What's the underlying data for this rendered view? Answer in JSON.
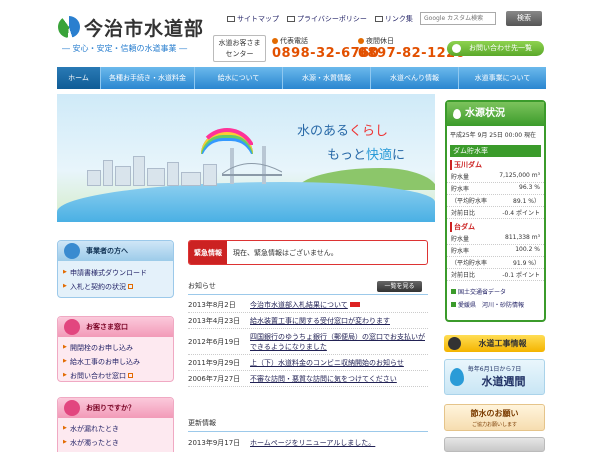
{
  "header": {
    "logo_title": "今治市水道部",
    "logo_sub": "― 安心・安定・信頼の水道事業 ―",
    "links": [
      "サイトマップ",
      "プライバシーポリシー",
      "リンク集"
    ],
    "search_placeholder": "Google カスタム検索",
    "search_button": "検索",
    "center_label_1": "水道お客さま",
    "center_label_2": "センター",
    "phone_main_label": "代表電話",
    "phone_main": "0898-32-6760",
    "phone_night_label": "夜間休日",
    "phone_night": "0897-82-1220",
    "contact_button": "お問い合わせ先一覧"
  },
  "nav": [
    "ホーム",
    "各種お手続き・水道料金",
    "給水について",
    "水源・水質情報",
    "水道べんり情報",
    "水道事業について"
  ],
  "hero": {
    "line1_a": "水のある",
    "line1_b": "くらし",
    "line2_a": "もっと",
    "line2_b": "快適",
    "line2_c": "に"
  },
  "dam": {
    "title": "水源状況",
    "date": "平成25年 9月 25日 00:00 現在",
    "subhead": "ダム貯水率",
    "dams": [
      {
        "name": "玉川ダム",
        "rows": [
          {
            "label": "貯水量",
            "value": "7,125,000 m³"
          },
          {
            "label": "貯水率",
            "value": "96.3 %"
          },
          {
            "label": "（平均貯水率",
            "value": "89.1 %）"
          },
          {
            "label": "対前日比",
            "value": "-0.4 ポイント"
          }
        ]
      },
      {
        "name": "台ダム",
        "rows": [
          {
            "label": "貯水量",
            "value": "811,338 m³"
          },
          {
            "label": "貯水率",
            "value": "100.2 %"
          },
          {
            "label": "（平均貯水率",
            "value": "91.9 %）"
          },
          {
            "label": "対前日比",
            "value": "-0.1 ポイント"
          }
        ]
      }
    ],
    "links": [
      "国土交通省データ",
      "愛媛県　河川・砂防情報"
    ]
  },
  "left": {
    "business": {
      "title": "事業者の方へ",
      "items": [
        "申請書様式ダウンロード",
        "入札と契約の状況"
      ]
    },
    "customer": {
      "title": "お客さま窓口",
      "items": [
        "開閉栓のお申し込み",
        "給水工事のお申し込み",
        "お問い合わせ窓口"
      ]
    },
    "trouble": {
      "title": "お困りですか？",
      "items": [
        "水が漏れたとき",
        "水が濁ったとき"
      ]
    }
  },
  "emergency": {
    "label": "緊急情報",
    "text": "現在、緊急情報はございません。"
  },
  "news": {
    "title": "お知らせ",
    "more": "一覧を見る",
    "items": [
      {
        "date": "2013年8月2日",
        "title": "今治市水道部入札結果について"
      },
      {
        "date": "2013年4月23日",
        "title": "給水装置工事に関する受付窓口が変わります"
      },
      {
        "date": "2012年6月19日",
        "title": "四国銀行のゆうちょ銀行（郵便局）の窓口でお支払いができるようになりました"
      },
      {
        "date": "2011年9月29日",
        "title": "上（下）水道料金のコンビニ収納開始のお知らせ"
      },
      {
        "date": "2006年7月27日",
        "title": "不審な訪問・悪質な訪問に気をつけてください"
      }
    ]
  },
  "updates": {
    "title": "更新情報",
    "items": [
      {
        "date": "2013年9月17日",
        "title": "ホームページをリニューアルしました。"
      }
    ]
  },
  "banners": {
    "construction": "水道工事情報",
    "week_small": "毎年6月1日から7日",
    "week_big": "水道週間",
    "save": "節水のお願い",
    "save_small": "ご協力お願いします"
  }
}
